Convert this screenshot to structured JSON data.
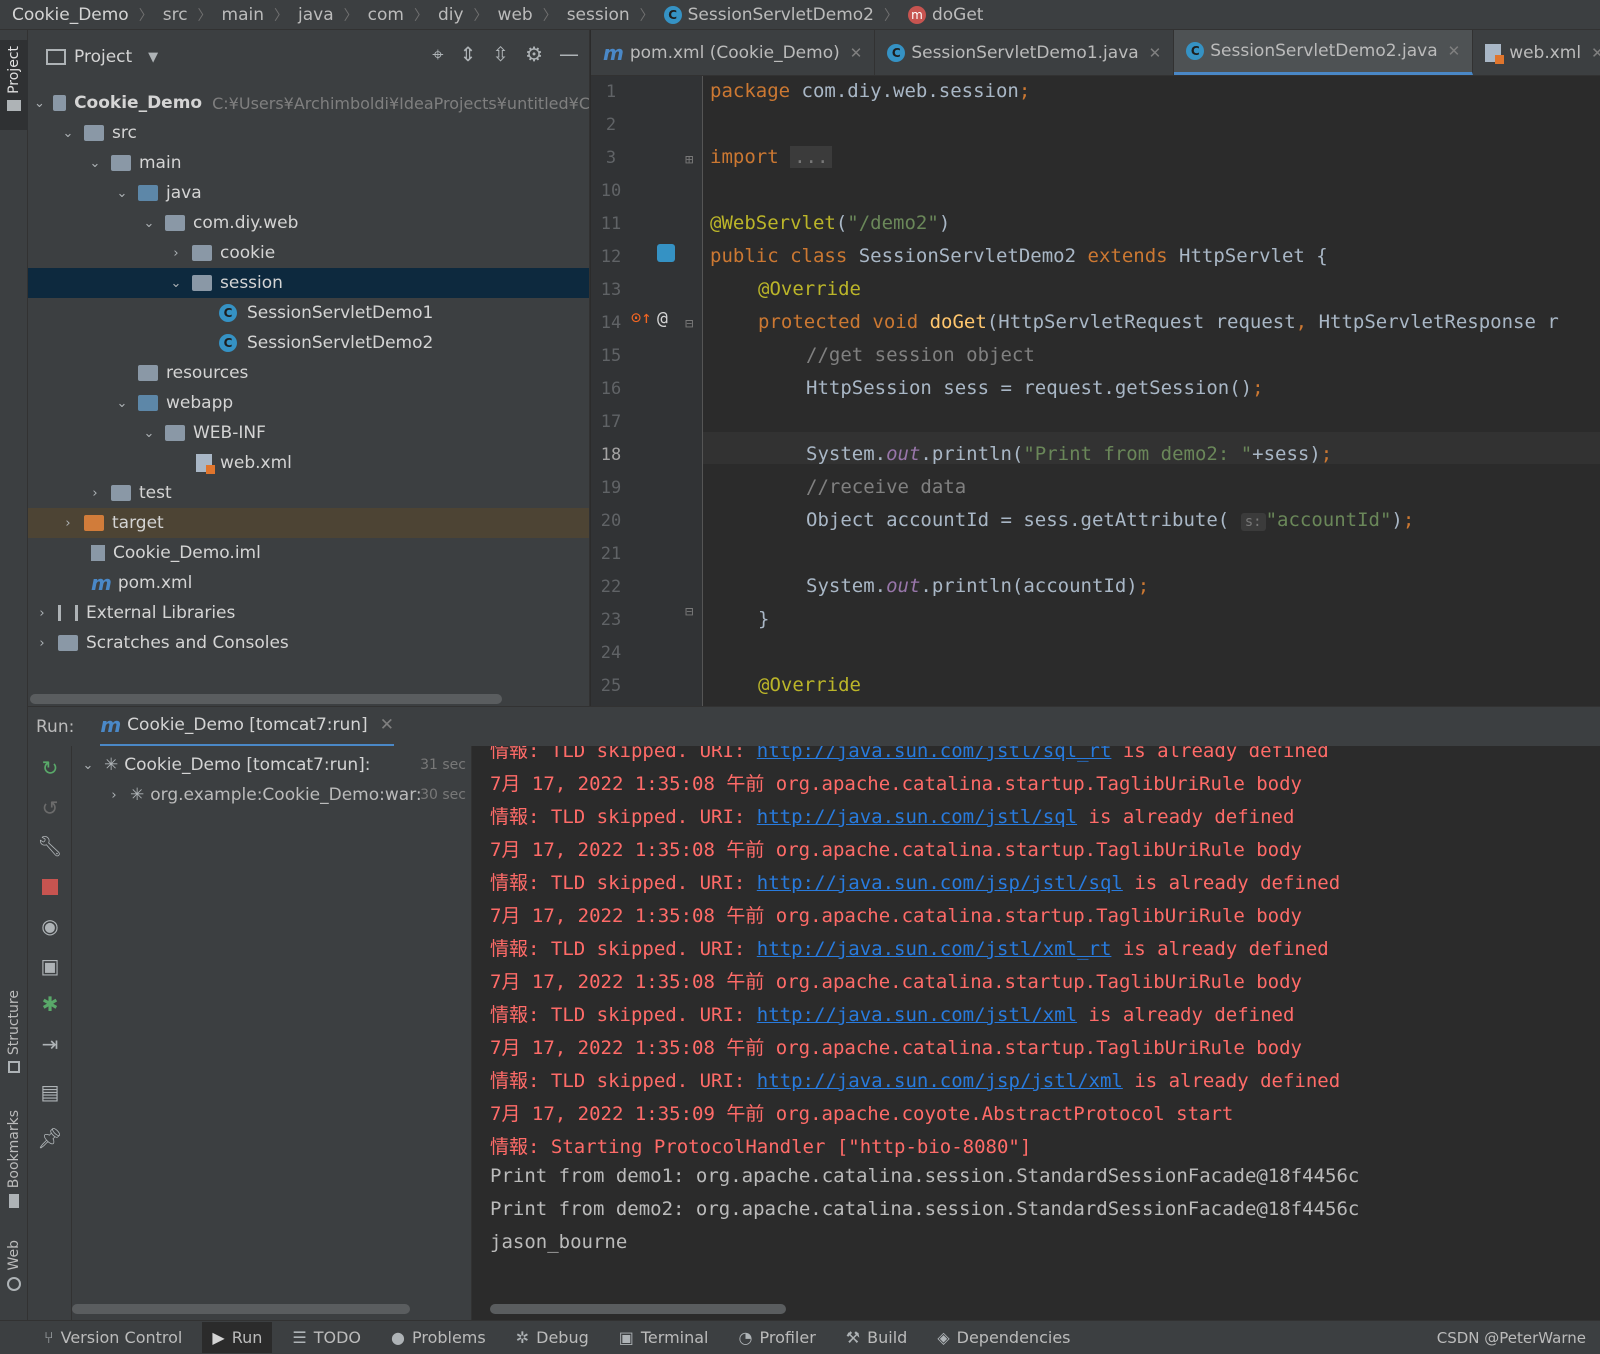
{
  "breadcrumb": {
    "items": [
      "Cookie_Demo",
      "src",
      "main",
      "java",
      "com",
      "diy",
      "web",
      "session",
      "SessionServletDemo2",
      "doGet"
    ]
  },
  "sidebar": {
    "project_tab": "Project",
    "structure_tab": "Structure",
    "bookmarks_tab": "Bookmarks",
    "web_tab": "Web"
  },
  "project": {
    "title": "Project",
    "root_path": "C:¥Users¥Archimboldi¥IdeaProjects¥untitled¥C",
    "tree": [
      {
        "label": "Cookie_Demo",
        "arrow": "⌄"
      },
      {
        "label": "src",
        "arrow": "⌄"
      },
      {
        "label": "main",
        "arrow": "⌄"
      },
      {
        "label": "java",
        "arrow": "⌄"
      },
      {
        "label": "com.diy.web",
        "arrow": "⌄"
      },
      {
        "label": "cookie",
        "arrow": "›"
      },
      {
        "label": "session",
        "arrow": "⌄"
      },
      {
        "label": "SessionServletDemo1",
        "arrow": ""
      },
      {
        "label": "SessionServletDemo2",
        "arrow": ""
      },
      {
        "label": "resources",
        "arrow": ""
      },
      {
        "label": "webapp",
        "arrow": "⌄"
      },
      {
        "label": "WEB-INF",
        "arrow": "⌄"
      },
      {
        "label": "web.xml",
        "arrow": ""
      },
      {
        "label": "test",
        "arrow": "›"
      },
      {
        "label": "target",
        "arrow": "›"
      },
      {
        "label": "Cookie_Demo.iml",
        "arrow": ""
      },
      {
        "label": "pom.xml",
        "arrow": ""
      },
      {
        "label": "External Libraries",
        "arrow": "›"
      },
      {
        "label": "Scratches and Consoles",
        "arrow": "›"
      }
    ]
  },
  "editor": {
    "tabs": [
      {
        "label": "pom.xml (Cookie_Demo)",
        "icon": "maven-icon"
      },
      {
        "label": "SessionServletDemo1.java",
        "icon": "class-icon"
      },
      {
        "label": "SessionServletDemo2.java",
        "icon": "class-icon",
        "active": true
      },
      {
        "label": "web.xml",
        "icon": "xml-file-icon"
      }
    ],
    "line_numbers": [
      "1",
      "2",
      "3",
      "10",
      "11",
      "12",
      "13",
      "14",
      "15",
      "16",
      "17",
      "18",
      "19",
      "20",
      "21",
      "22",
      "23",
      "24",
      "25"
    ],
    "current_line": "18",
    "code": {
      "l1_kw": "package",
      "l1_rest": " com.diy.web.session",
      "l1_semi": ";",
      "l3_kw": "import",
      "l3_fold": "...",
      "l11_ann": "@WebServlet",
      "l11_open": "(",
      "l11_str": "\"/demo2\"",
      "l11_close": ")",
      "l12_kw1": "public class",
      "l12_name": " SessionServletDemo2 ",
      "l12_kw2": "extends",
      "l12_rest": " HttpServlet {",
      "l13_ann": "@Override",
      "l14_kw": "protected void",
      "l14_fn": "doGet",
      "l14_rest": "(HttpServletRequest request",
      "l14_comma": ",",
      "l14_rest2": " HttpServletResponse r",
      "l15_cmt": "//get session object",
      "l16_code": "HttpSession sess = request.getSession()",
      "l16_semi": ";",
      "l18_pre": "System.",
      "l18_out": "out",
      "l18_mid": ".println(",
      "l18_str": "\"Print from demo2: \"",
      "l18_post": "+sess)",
      "l18_semi": ";",
      "l19_cmt": "//receive data",
      "l20_pre": "Object accountId = sess.getAttribute(",
      "l20_hint": "s:",
      "l20_str": "\"accountId\"",
      "l20_post": ")",
      "l20_semi": ";",
      "l22_pre": "System.",
      "l22_out": "out",
      "l22_post": ".println(accountId)",
      "l22_semi": ";",
      "l23": "}",
      "l25_ann": "@Override"
    }
  },
  "run": {
    "label": "Run:",
    "tab_label": "Cookie_Demo [tomcat7:run]",
    "tree": [
      {
        "label": "Cookie_Demo [tomcat7:run]:",
        "time": "31 sec"
      },
      {
        "label": "org.example:Cookie_Demo:war:",
        "time": "30 sec"
      }
    ],
    "console": [
      {
        "type": "info",
        "prefix": "情報: TLD skipped. URI: ",
        "link": "http://java.sun.com/jstl/sql_rt",
        "suffix": " is already defined"
      },
      {
        "type": "err",
        "text": "7月 17, 2022 1:35:08 午前 org.apache.catalina.startup.TaglibUriRule body"
      },
      {
        "type": "info",
        "prefix": "情報: TLD skipped. URI: ",
        "link": "http://java.sun.com/jstl/sql",
        "suffix": " is already defined"
      },
      {
        "type": "err",
        "text": "7月 17, 2022 1:35:08 午前 org.apache.catalina.startup.TaglibUriRule body"
      },
      {
        "type": "info",
        "prefix": "情報: TLD skipped. URI: ",
        "link": "http://java.sun.com/jsp/jstl/sql",
        "suffix": " is already defined"
      },
      {
        "type": "err",
        "text": "7月 17, 2022 1:35:08 午前 org.apache.catalina.startup.TaglibUriRule body"
      },
      {
        "type": "info",
        "prefix": "情報: TLD skipped. URI: ",
        "link": "http://java.sun.com/jstl/xml_rt",
        "suffix": " is already defined"
      },
      {
        "type": "err",
        "text": "7月 17, 2022 1:35:08 午前 org.apache.catalina.startup.TaglibUriRule body"
      },
      {
        "type": "info",
        "prefix": "情報: TLD skipped. URI: ",
        "link": "http://java.sun.com/jstl/xml",
        "suffix": " is already defined"
      },
      {
        "type": "err",
        "text": "7月 17, 2022 1:35:08 午前 org.apache.catalina.startup.TaglibUriRule body"
      },
      {
        "type": "info",
        "prefix": "情報: TLD skipped. URI: ",
        "link": "http://java.sun.com/jsp/jstl/xml",
        "suffix": " is already defined"
      },
      {
        "type": "err",
        "text": "7月 17, 2022 1:35:09 午前 org.apache.coyote.AbstractProtocol start"
      },
      {
        "type": "err",
        "text": "情報: Starting ProtocolHandler [\"http-bio-8080\"]"
      },
      {
        "type": "out",
        "text": "Print from demo1: org.apache.catalina.session.StandardSessionFacade@18f4456c"
      },
      {
        "type": "out",
        "text": "Print from demo2: org.apache.catalina.session.StandardSessionFacade@18f4456c"
      },
      {
        "type": "out",
        "text": "jason_bourne"
      }
    ]
  },
  "statusbar": {
    "items": [
      "Version Control",
      "Run",
      "TODO",
      "Problems",
      "Debug",
      "Terminal",
      "Profiler",
      "Build",
      "Dependencies"
    ],
    "credit": "CSDN @PeterWarne"
  }
}
